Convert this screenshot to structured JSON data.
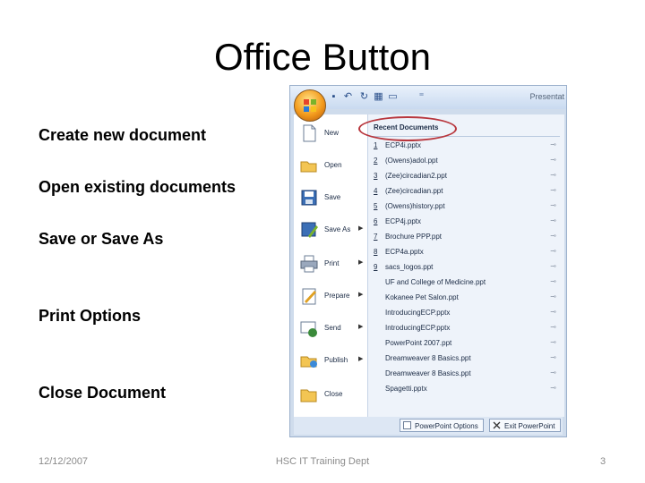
{
  "slide": {
    "title": "Office Button",
    "bullets": [
      "Create new document",
      "Open existing documents",
      "Save or Save As",
      "Print Options",
      "Close Document"
    ],
    "footer": {
      "date": "12/12/2007",
      "center": "HSC IT Training Dept",
      "page": "3"
    }
  },
  "window": {
    "title": "Presentat",
    "qat_icons": [
      "save-icon",
      "undo-icon",
      "redo-icon",
      "chart-icon",
      "folder-icon",
      "customize-icon"
    ],
    "menu": {
      "items": [
        {
          "label": "New",
          "icon": "new-document-icon",
          "arrow": false
        },
        {
          "label": "Open",
          "icon": "open-folder-icon",
          "arrow": false
        },
        {
          "label": "Save",
          "icon": "save-disk-icon",
          "arrow": false
        },
        {
          "label": "Save As",
          "icon": "save-as-icon",
          "arrow": true
        },
        {
          "label": "Print",
          "icon": "printer-icon",
          "arrow": true
        },
        {
          "label": "Prepare",
          "icon": "prepare-icon",
          "arrow": true
        },
        {
          "label": "Send",
          "icon": "send-icon",
          "arrow": true
        },
        {
          "label": "Publish",
          "icon": "publish-icon",
          "arrow": true
        },
        {
          "label": "Close",
          "icon": "close-folder-icon",
          "arrow": false
        }
      ],
      "recent_header": "Recent Documents",
      "recent": [
        {
          "num": "1",
          "name": "ECP4i.pptx"
        },
        {
          "num": "2",
          "name": "(Owens)adol.ppt"
        },
        {
          "num": "3",
          "name": "(Zee)circadian2.ppt"
        },
        {
          "num": "4",
          "name": "(Zee)circadian.ppt"
        },
        {
          "num": "5",
          "name": "(Owens)history.ppt"
        },
        {
          "num": "6",
          "name": "ECP4j.pptx"
        },
        {
          "num": "7",
          "name": "Brochure PPP.ppt"
        },
        {
          "num": "8",
          "name": "ECP4a.pptx"
        },
        {
          "num": "9",
          "name": "sacs_logos.ppt"
        },
        {
          "num": "",
          "name": "UF and College of Medicine.ppt"
        },
        {
          "num": "",
          "name": "Kokanee Pet Salon.ppt"
        },
        {
          "num": "",
          "name": "IntroducingECP.pptx"
        },
        {
          "num": "",
          "name": "IntroducingECP.pptx"
        },
        {
          "num": "",
          "name": "PowerPoint 2007.ppt"
        },
        {
          "num": "",
          "name": "Dreamweaver 8 Basics.ppt"
        },
        {
          "num": "",
          "name": "Dreamweaver 8 Basics.ppt"
        },
        {
          "num": "",
          "name": "Spagetti.pptx"
        }
      ],
      "options_button": "PowerPoint Options",
      "exit_button": "Exit PowerPoint"
    },
    "colors": {
      "highlight_ellipse": "#b8363d"
    }
  }
}
